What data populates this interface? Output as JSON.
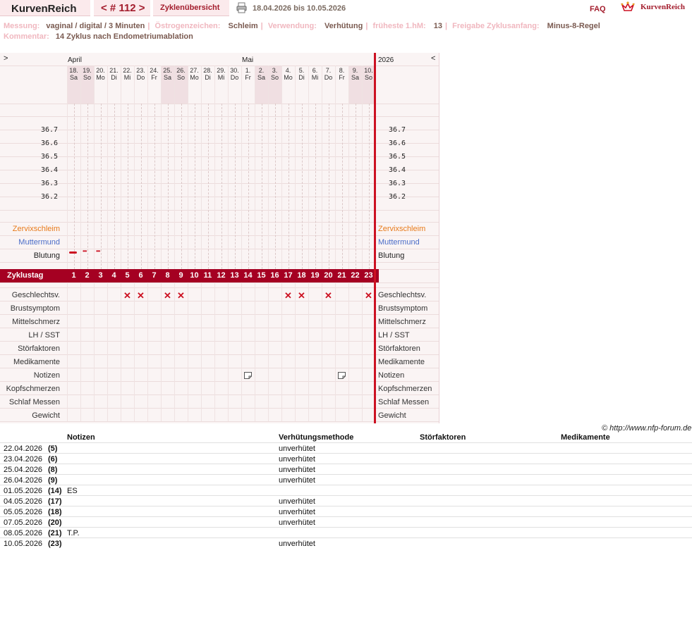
{
  "header": {
    "brand": "KurvenReich",
    "cycle_nav": "< # 112 >",
    "overview_link": "Zyklenübersicht",
    "date_range": "18.04.2026 bis 10.05.2026",
    "faq": "FAQ",
    "logo_text": "KurvenReich"
  },
  "info": {
    "messung_label": "Messung:",
    "messung": "vaginal / digital / 3 Minuten",
    "oestrogen_label": "Östrogenzeichen:",
    "oestrogen": "Schleim",
    "verwendung_label": "Verwendung:",
    "verwendung": "Verhütung",
    "frueheste_label": "früheste 1.hM:",
    "frueheste": "13",
    "freigabe_label": "Freigabe Zyklusanfang:",
    "freigabe": "Minus-8-Regel",
    "kommentar_label": "Kommentar:",
    "kommentar": "14 Zyklus nach Endometriumablation"
  },
  "chart": {
    "nav_left": ">",
    "nav_right": "<",
    "month_april": "April",
    "month_mai": "Mai",
    "year": "2026",
    "days": [
      {
        "d": "18.",
        "w": "Sa"
      },
      {
        "d": "19.",
        "w": "So"
      },
      {
        "d": "20.",
        "w": "Mo"
      },
      {
        "d": "21.",
        "w": "Di"
      },
      {
        "d": "22.",
        "w": "Mi"
      },
      {
        "d": "23.",
        "w": "Do"
      },
      {
        "d": "24.",
        "w": "Fr"
      },
      {
        "d": "25.",
        "w": "Sa"
      },
      {
        "d": "26.",
        "w": "So"
      },
      {
        "d": "27.",
        "w": "Mo"
      },
      {
        "d": "28.",
        "w": "Di"
      },
      {
        "d": "29.",
        "w": "Mi"
      },
      {
        "d": "30.",
        "w": "Do"
      },
      {
        "d": "1.",
        "w": "Fr"
      },
      {
        "d": "2.",
        "w": "Sa"
      },
      {
        "d": "3.",
        "w": "So"
      },
      {
        "d": "4.",
        "w": "Mo"
      },
      {
        "d": "5.",
        "w": "Di"
      },
      {
        "d": "6.",
        "w": "Mi"
      },
      {
        "d": "7.",
        "w": "Do"
      },
      {
        "d": "8.",
        "w": "Fr"
      },
      {
        "d": "9.",
        "w": "Sa"
      },
      {
        "d": "10.",
        "w": "So"
      }
    ],
    "temp_ticks": [
      "36.7",
      "36.6",
      "36.5",
      "36.4",
      "36.3",
      "36.2"
    ],
    "rows": {
      "zervix": "Zervixschleim",
      "muttermund": "Muttermund",
      "blutung": "Blutung",
      "zyklustag": "Zyklustag",
      "geschlecht": "Geschlechtsv.",
      "brust": "Brustsymptom",
      "mittel": "Mittelschmerz",
      "lh": "LH / SST",
      "stoer": "Störfaktoren",
      "medi": "Medikamente",
      "notizen": "Notizen",
      "kopf": "Kopfschmerzen",
      "schlaf": "Schlaf Messen",
      "gewicht": "Gewicht"
    },
    "cycle_days": [
      "1",
      "2",
      "3",
      "4",
      "5",
      "6",
      "7",
      "8",
      "9",
      "10",
      "11",
      "12",
      "13",
      "14",
      "15",
      "16",
      "17",
      "18",
      "19",
      "20",
      "21",
      "22",
      "23"
    ],
    "intercourse_marks": [
      5,
      6,
      8,
      9,
      17,
      18,
      20,
      23
    ],
    "note_marks": [
      14,
      21
    ],
    "bleeding": [
      {
        "day": 1,
        "type": "heavy"
      },
      {
        "day": 2,
        "type": "spotting"
      },
      {
        "day": 3,
        "type": "spotting"
      }
    ],
    "colors": {
      "accent": "#a50022",
      "zervix": "#e87a1a",
      "muttermund": "#4a6cc8",
      "redline": "#cc1122"
    }
  },
  "footer": {
    "copyright": "© http://www.nfp-forum.de"
  },
  "table": {
    "headers": [
      "Notizen",
      "Verhütungsmethode",
      "Störfaktoren",
      "Medikamente"
    ],
    "rows": [
      {
        "date": "22.04.2026",
        "day": "(5)",
        "note": "",
        "method": "unverhütet"
      },
      {
        "date": "23.04.2026",
        "day": "(6)",
        "note": "",
        "method": "unverhütet"
      },
      {
        "date": "25.04.2026",
        "day": "(8)",
        "note": "",
        "method": "unverhütet"
      },
      {
        "date": "26.04.2026",
        "day": "(9)",
        "note": "",
        "method": "unverhütet"
      },
      {
        "date": "01.05.2026",
        "day": "(14)",
        "note": "ES",
        "method": ""
      },
      {
        "date": "04.05.2026",
        "day": "(17)",
        "note": "",
        "method": "unverhütet"
      },
      {
        "date": "05.05.2026",
        "day": "(18)",
        "note": "",
        "method": "unverhütet"
      },
      {
        "date": "07.05.2026",
        "day": "(20)",
        "note": "",
        "method": "unverhütet"
      },
      {
        "date": "08.05.2026",
        "day": "(21)",
        "note": "T.P.",
        "method": ""
      },
      {
        "date": "10.05.2026",
        "day": "(23)",
        "note": "",
        "method": "unverhütet"
      }
    ]
  }
}
